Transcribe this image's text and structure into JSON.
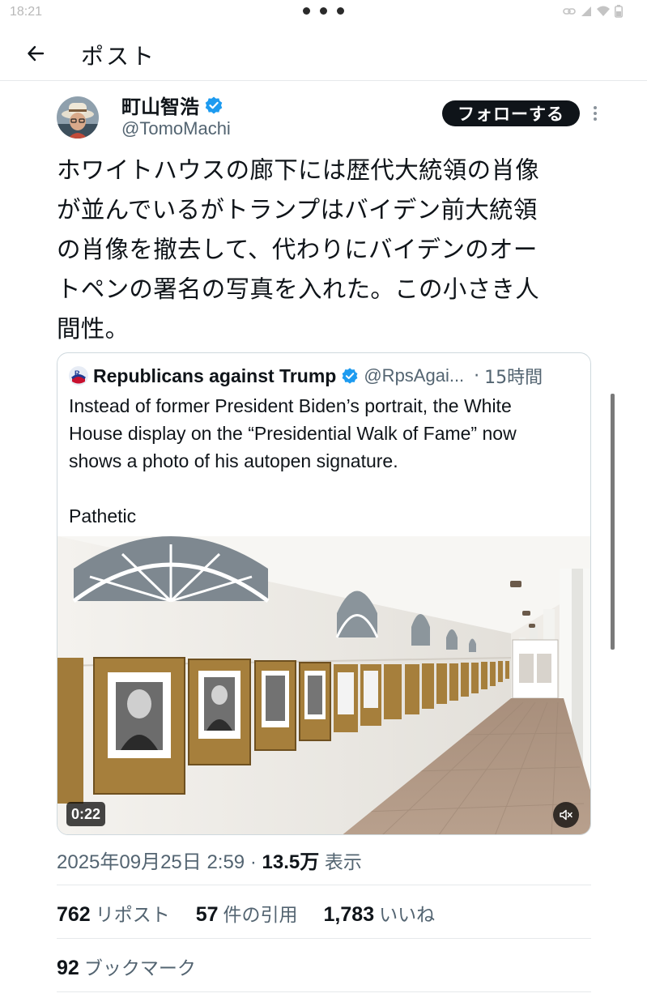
{
  "status_bar": {
    "time": "18:21"
  },
  "header": {
    "title": "ポスト"
  },
  "tweet": {
    "author_name": "町山智浩",
    "author_handle": "@TomoMachi",
    "follow_label": "フォローする",
    "text": "ホワイトハウスの廊下には歴代大統領の肖像\nが並んでいるがトランプはバイデン前大統領\nの肖像を撤去して、代わりにバイデンのオー\nトペンの署名の写真を入れた。この小さき人\n間性。"
  },
  "quote": {
    "name": "Republicans against Trump",
    "handle": "@RpsAgai...",
    "separator": "·",
    "time": "15時間",
    "text": "Instead of former President Biden’s portrait, the White\nHouse display on the “Presidential Walk of Fame” now\nshows a photo of his autopen signature.\n\nPathetic",
    "video_duration": "0:22"
  },
  "meta": {
    "timestamp": "2025年09月25日 2:59",
    "separator": "·",
    "views_count": "13.5万",
    "views_label": "表示"
  },
  "stats": [
    {
      "count": "762",
      "label": "リポスト"
    },
    {
      "count": "57",
      "label": "件の引用"
    },
    {
      "count": "1,783",
      "label": "いいね"
    }
  ],
  "bookmarks": {
    "count": "92",
    "label": "ブックマーク"
  },
  "colors": {
    "verified": "#1d9bf0",
    "text": "#0f1419",
    "secondary": "#536471",
    "border": "#cfd9de"
  }
}
